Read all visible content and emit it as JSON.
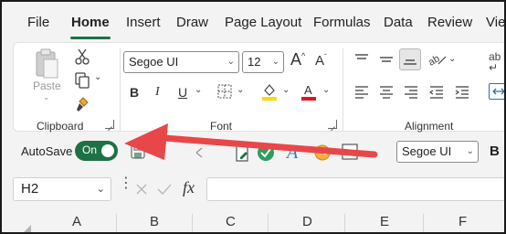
{
  "menu": {
    "tabs": [
      "File",
      "Home",
      "Insert",
      "Draw",
      "Page Layout",
      "Formulas",
      "Data",
      "Review",
      "View"
    ],
    "active": "Home"
  },
  "ribbon": {
    "clipboard": {
      "paste_label": "Paste",
      "group_label": "Clipboard"
    },
    "font": {
      "font_name": "Segoe UI",
      "font_size": "12",
      "group_label": "Font"
    },
    "alignment": {
      "group_label": "Alignment",
      "wrap_partial": "ab"
    }
  },
  "qat": {
    "autosave_label": "AutoSave",
    "toggle_text": "On",
    "font_name": "Segoe UI",
    "bold_label": "B"
  },
  "formula_bar": {
    "name_box": "H2",
    "fx": "fx"
  },
  "columns": [
    "A",
    "B",
    "C",
    "D",
    "E",
    "F"
  ],
  "colors": {
    "accent": "#1e7145",
    "arrow": "#e8474a",
    "highlight": "#ffd800",
    "font_color": "#e81123"
  }
}
